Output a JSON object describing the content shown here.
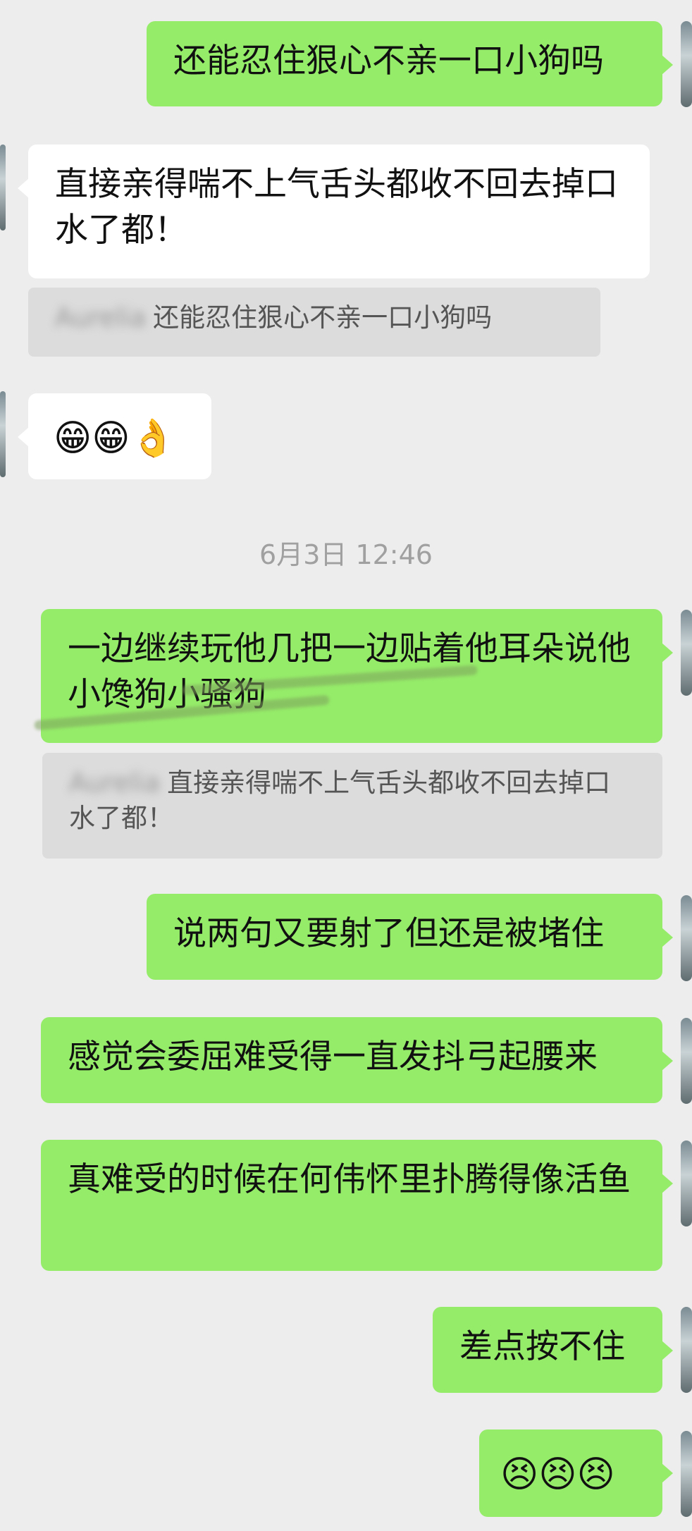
{
  "messages": [
    {
      "side": "right",
      "text": "还能忍住狠心不亲一口小狗吗"
    },
    {
      "side": "left",
      "text": "直接亲得喘不上气舌头都收不回去掉口水了都！",
      "quote": {
        "sender": "Aurelia",
        "text": "还能忍住狠心不亲一口小狗吗"
      }
    },
    {
      "side": "left",
      "emojis": [
        "😁",
        "😁",
        "👌"
      ]
    },
    {
      "timestamp": "6月3日 12:46"
    },
    {
      "side": "right",
      "text": "一边继续玩他几把一边贴着他耳朵说他小馋狗小骚狗",
      "quote": {
        "sender": "Aurelia",
        "text": "直接亲得喘不上气舌头都收不回去掉口水了都！"
      }
    },
    {
      "side": "right",
      "text": "说两句又要射了但还是被堵住"
    },
    {
      "side": "right",
      "text": "感觉会委屈难受得一直发抖弓起腰来"
    },
    {
      "side": "right",
      "text": "真难受的时候在何伟怀里扑腾得像活鱼"
    },
    {
      "side": "right",
      "text": "差点按不住"
    },
    {
      "side": "right",
      "emojis": [
        "😣",
        "😣",
        "😣"
      ]
    }
  ],
  "colors": {
    "background": "#ededed",
    "outgoing": "#95ec69",
    "incoming": "#ffffff",
    "quote": "#dcdcdc"
  }
}
